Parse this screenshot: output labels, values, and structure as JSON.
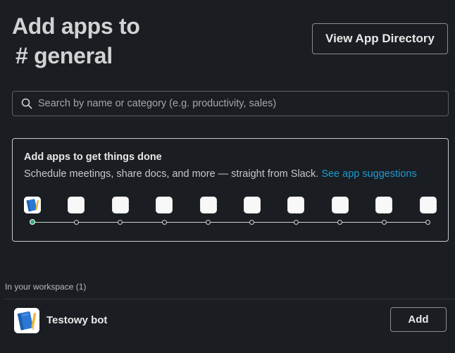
{
  "header": {
    "title_line1": "Add apps to",
    "title_line2": "# general",
    "directory_button": "View App Directory"
  },
  "search": {
    "placeholder": "Search by name or category (e.g. productivity, sales)",
    "value": "",
    "icon": "search-icon"
  },
  "suggestions_card": {
    "title": "Add apps to get things done",
    "subtitle": "Schedule meetings, share docs, and more — straight from Slack.",
    "link": "See app suggestions",
    "link_color": "#1d9bd1",
    "step_count": 10,
    "active_step": 1,
    "active_color": "#2bac76"
  },
  "workspace": {
    "label": "In your workspace (1)",
    "apps": [
      {
        "name": "Testowy bot",
        "icon": "notebook-icon",
        "action_label": "Add"
      }
    ]
  },
  "colors": {
    "background": "#1a1d21",
    "text": "#d1d2d3"
  }
}
